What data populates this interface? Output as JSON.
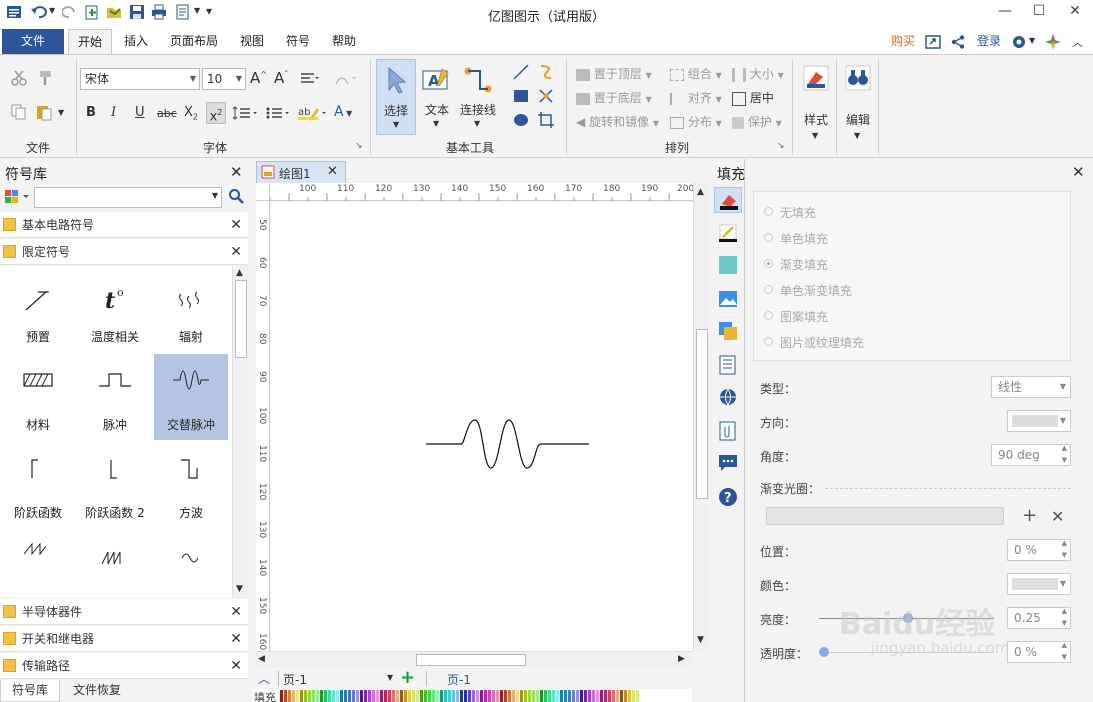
{
  "app": {
    "title": "亿图图示（试用版）"
  },
  "tabs": {
    "file": "文件",
    "home": "开始",
    "insert": "插入",
    "layout": "页面布局",
    "view": "视图",
    "symbol": "符号",
    "help": "帮助"
  },
  "toprights": {
    "buy": "购买",
    "login": "登录"
  },
  "ribbon": {
    "group_file": "文件",
    "group_font": "字体",
    "group_basic": "基本工具",
    "group_arrange": "排列",
    "font_name": "宋体",
    "font_size": "10",
    "select": "选择",
    "text": "文本",
    "connector": "连接线",
    "bring_front": "置于顶层",
    "send_back": "置于底层",
    "rotate_mirror": "旋转和镜像",
    "group": "组合",
    "align": "对齐",
    "distribute": "分布",
    "size": "大小",
    "center": "居中",
    "protect": "保护",
    "style": "样式",
    "edit": "编辑"
  },
  "library": {
    "title": "符号库",
    "sections_top": [
      "基本电路符号",
      "限定符号"
    ],
    "symbols": [
      {
        "label": "预置",
        "icon": "preset-icon"
      },
      {
        "label": "温度相关",
        "icon": "temperature-icon"
      },
      {
        "label": "辐射",
        "icon": "radiation-icon"
      },
      {
        "label": "材料",
        "icon": "material-icon"
      },
      {
        "label": "脉冲",
        "icon": "pulse-icon"
      },
      {
        "label": "交替脉冲",
        "icon": "alternating-pulse-icon"
      },
      {
        "label": "阶跃函数",
        "icon": "step-function-icon"
      },
      {
        "label": "阶跃函数 2",
        "icon": "step-function-2-icon"
      },
      {
        "label": "方波",
        "icon": "square-wave-icon"
      }
    ],
    "sections_bottom": [
      "半导体器件",
      "开关和继电器",
      "传输路径"
    ],
    "bottom_tabs": [
      "符号库",
      "文件恢复"
    ]
  },
  "document": {
    "tab": "绘图1",
    "ruler_h": [
      "100",
      "110",
      "120",
      "130",
      "140",
      "150",
      "160",
      "170",
      "180",
      "190",
      "200"
    ],
    "ruler_v": [
      "50",
      "60",
      "70",
      "80",
      "90",
      "100",
      "110",
      "120",
      "130",
      "140",
      "150",
      "160"
    ],
    "page_selector": "页-1",
    "page_tab": "页-1",
    "fill_label": "填充"
  },
  "fill_panel": {
    "title": "填充",
    "options": [
      "无填充",
      "单色填充",
      "渐变填充",
      "单色渐变填充",
      "图案填充",
      "图片或纹理填充"
    ],
    "type_label": "类型：",
    "type_value": "线性",
    "direction_label": "方向：",
    "angle_label": "角度：",
    "angle_value": "90 deg",
    "gradient_label": "渐变光圈：",
    "position_label": "位置：",
    "position_value": "0 %",
    "color_label": "颜色：",
    "brightness_label": "亮度：",
    "brightness_value": "0.25",
    "transparency_label": "透明度：",
    "transparency_value": "0 %"
  },
  "watermark": {
    "brand": "Baidu经验",
    "url": "jingyan.baidu.com"
  }
}
